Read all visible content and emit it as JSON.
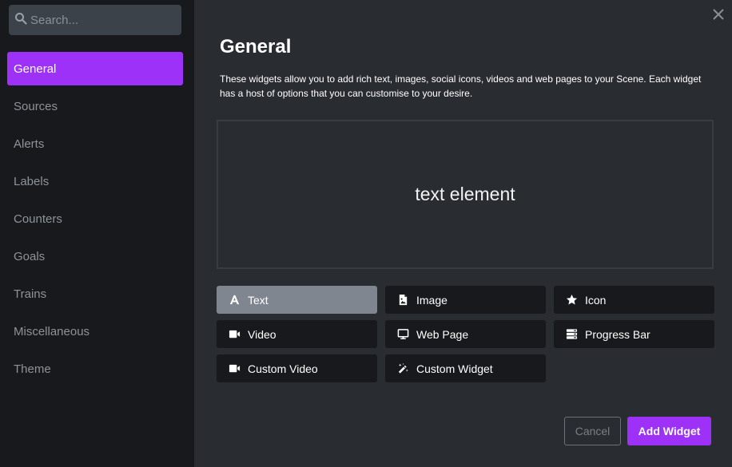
{
  "search": {
    "placeholder": "Search..."
  },
  "sidebar": {
    "items": [
      {
        "label": "General",
        "active": true
      },
      {
        "label": "Sources"
      },
      {
        "label": "Alerts"
      },
      {
        "label": "Labels"
      },
      {
        "label": "Counters"
      },
      {
        "label": "Goals"
      },
      {
        "label": "Trains"
      },
      {
        "label": "Miscellaneous"
      },
      {
        "label": "Theme"
      }
    ]
  },
  "main": {
    "title": "General",
    "description": "These widgets allow you to add rich text, images, social icons, videos and web pages to your Scene. Each widget has a host of options that you can customise to your desire.",
    "preview_text": "text element",
    "widgets": [
      {
        "label": "Text",
        "icon": "font-icon",
        "active": true
      },
      {
        "label": "Image",
        "icon": "file-image-icon"
      },
      {
        "label": "Icon",
        "icon": "star-icon"
      },
      {
        "label": "Video",
        "icon": "video-camera-icon"
      },
      {
        "label": "Web Page",
        "icon": "monitor-icon"
      },
      {
        "label": "Progress Bar",
        "icon": "server-stack-icon"
      },
      {
        "label": "Custom Video",
        "icon": "video-camera-icon"
      },
      {
        "label": "Custom Widget",
        "icon": "magic-wand-icon"
      }
    ]
  },
  "footer": {
    "cancel_label": "Cancel",
    "add_label": "Add Widget"
  },
  "colors": {
    "accent": "#9d31f7",
    "sidebar_bg": "#17191c",
    "main_bg": "#292d32",
    "selected_widget": "#80868f"
  }
}
